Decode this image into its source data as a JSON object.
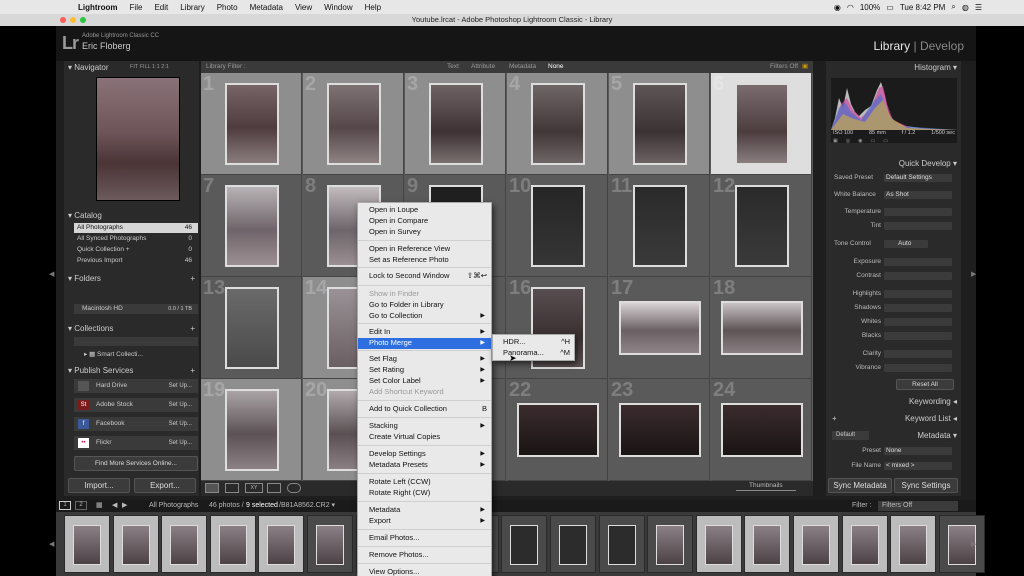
{
  "menubar": {
    "app": "Lightroom",
    "items": [
      "File",
      "Edit",
      "Library",
      "Photo",
      "Metadata",
      "View",
      "Window",
      "Help"
    ],
    "battery": "100%",
    "clock": "Tue 8:42 PM"
  },
  "window": {
    "title": "Youtube.lrcat - Adobe Photoshop Lightroom Classic - Library"
  },
  "identity": {
    "product": "Adobe Lightroom Classic CC",
    "user": "Eric Floberg",
    "module_library": "Library",
    "module_separator": "|",
    "module_develop": "Develop"
  },
  "left": {
    "navigator": "Navigator",
    "zoom": [
      "FIT",
      "FILL",
      "1:1",
      "2:1"
    ],
    "catalog": {
      "title": "Catalog",
      "rows": [
        {
          "label": "All Photographs",
          "count": "46"
        },
        {
          "label": "All Synced Photographs",
          "count": "0"
        },
        {
          "label": "Quick Collection +",
          "count": "0"
        },
        {
          "label": "Previous Import",
          "count": "46"
        }
      ]
    },
    "folders": {
      "title": "Folders",
      "drive": "Macintosh HD",
      "space": "0.0 / 1 TB"
    },
    "collections": {
      "title": "Collections",
      "smart": "Smart Collecti..."
    },
    "publish": {
      "title": "Publish Services",
      "services": [
        {
          "name": "Hard Drive",
          "action": "Set Up..."
        },
        {
          "name": "Adobe Stock",
          "action": "Set Up...",
          "icon": "St"
        },
        {
          "name": "Facebook",
          "action": "Set Up...",
          "icon": "f"
        },
        {
          "name": "Flickr",
          "action": "Set Up...",
          "icon": "••"
        }
      ],
      "find_more": "Find More Services Online..."
    },
    "import": "Import...",
    "export": "Export..."
  },
  "filter": {
    "label": "Library Filter :",
    "text": "Text",
    "attribute": "Attribute",
    "metadata": "Metadata",
    "none": "None",
    "filters_off": "Filters Off"
  },
  "grid": {
    "numbers": [
      "1",
      "2",
      "3",
      "4",
      "5",
      "6",
      "7",
      "8",
      "9",
      "10",
      "11",
      "12",
      "13",
      "14",
      "15",
      "16",
      "17",
      "18",
      "19",
      "20",
      "21",
      "22",
      "23",
      "24"
    ]
  },
  "toolbar": {
    "thumbnails": "Thumbnails"
  },
  "right": {
    "histogram": "Histogram",
    "exif": {
      "iso": "ISO 100",
      "focal": "85 mm",
      "aperture": "f / 1.2",
      "shutter": "1/500 sec"
    },
    "quick_develop": "Quick Develop",
    "saved_preset": "Saved Preset",
    "saved_preset_val": "Default Settings",
    "white_balance": "White Balance",
    "white_balance_val": "As Shot",
    "temperature": "Temperature",
    "tint": "Tint",
    "tone_control": "Tone Control",
    "auto": "Auto",
    "exposure": "Exposure",
    "contrast": "Contrast",
    "highlights": "Highlights",
    "shadows": "Shadows",
    "whites": "Whites",
    "blacks": "Blacks",
    "clarity": "Clarity",
    "vibrance": "Vibrance",
    "reset_all": "Reset All",
    "keywording": "Keywording",
    "keyword_list": "Keyword List",
    "metadata": "Metadata",
    "meta_default": "Default",
    "preset": "Preset",
    "preset_val": "None",
    "file_name": "File Name",
    "file_name_val": "< mixed >",
    "sync_metadata": "Sync Metadata",
    "sync_settings": "Sync Settings"
  },
  "filmstrip": {
    "pages": [
      "1",
      "2"
    ],
    "source": "All Photographs",
    "selection": "46 photos /",
    "selected": "9 selected",
    "file": "/B81A8562.CR2 ▾",
    "filter": "Filter :",
    "filter_val": "Filters Off"
  },
  "context_menu": {
    "items": [
      {
        "label": "Open in Loupe"
      },
      {
        "label": "Open in Compare"
      },
      {
        "label": "Open in Survey"
      },
      {
        "label": "Open in Reference View"
      },
      {
        "label": "Set as Reference Photo"
      },
      {
        "label": "Lock to Second Window",
        "shortcut": "⇧⌘↩"
      },
      {
        "label": "Show in Finder"
      },
      {
        "label": "Go to Folder in Library"
      },
      {
        "label": "Go to Collection",
        "arrow": "▶"
      },
      {
        "label": "Edit In",
        "arrow": "▶"
      },
      {
        "label": "Photo Merge",
        "arrow": "▶"
      },
      {
        "label": "Set Flag",
        "arrow": "▶"
      },
      {
        "label": "Set Rating",
        "arrow": "▶"
      },
      {
        "label": "Set Color Label",
        "arrow": "▶"
      },
      {
        "label": "Add Shortcut Keyword"
      },
      {
        "label": "Add to Quick Collection",
        "shortcut": "B"
      },
      {
        "label": "Stacking",
        "arrow": "▶"
      },
      {
        "label": "Create Virtual Copies"
      },
      {
        "label": "Develop Settings",
        "arrow": "▶"
      },
      {
        "label": "Metadata Presets",
        "arrow": "▶"
      },
      {
        "label": "Rotate Left (CCW)"
      },
      {
        "label": "Rotate Right (CW)"
      },
      {
        "label": "Metadata",
        "arrow": "▶"
      },
      {
        "label": "Export",
        "arrow": "▶"
      },
      {
        "label": "Email Photos..."
      },
      {
        "label": "Remove Photos..."
      },
      {
        "label": "View Options..."
      }
    ],
    "submenu": [
      {
        "label": "HDR...",
        "shortcut": "^H"
      },
      {
        "label": "Panorama...",
        "shortcut": "^M"
      }
    ]
  },
  "colors": {
    "menu_highlight": "#2d6fe0",
    "panel_bg": "#2a2a2a",
    "grid_bg": "#5a5a5a"
  }
}
